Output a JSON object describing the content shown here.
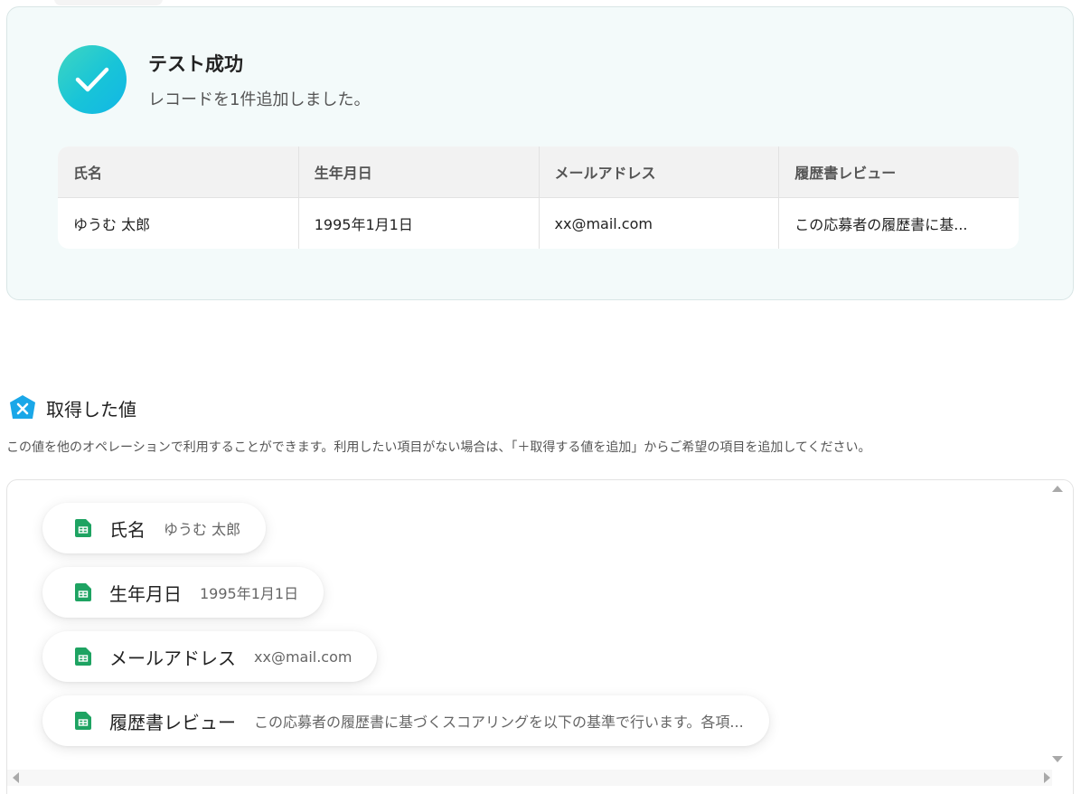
{
  "success": {
    "title": "テスト成功",
    "subtitle": "レコードを1件追加しました。",
    "icon": "check-icon",
    "accent": "#18c4d8"
  },
  "result_table": {
    "headers": [
      "氏名",
      "生年月日",
      "メールアドレス",
      "履歴書レビュー"
    ],
    "row": [
      "ゆうむ 太郎",
      "1995年1月1日",
      "xx@mail.com",
      "この応募者の履歴書に基..."
    ]
  },
  "section": {
    "title": "取得した値",
    "description": "この値を他のオペレーションで利用することができます。利用したい項目がない場合は、「＋取得する値を追加」からご希望の項目を追加してください。",
    "icon": "variable-x-icon",
    "icon_color": "#1aa7e8"
  },
  "values": [
    {
      "label": "氏名",
      "value": "ゆうむ 太郎",
      "icon": "spreadsheet-icon"
    },
    {
      "label": "生年月日",
      "value": "1995年1月1日",
      "icon": "spreadsheet-icon"
    },
    {
      "label": "メールアドレス",
      "value": "xx@mail.com",
      "icon": "spreadsheet-icon"
    },
    {
      "label": "履歴書レビュー",
      "value": "この応募者の履歴書に基づくスコアリングを以下の基準で行います。各項...",
      "icon": "spreadsheet-icon"
    }
  ],
  "colors": {
    "sheet_green": "#1ea362",
    "card_bg": "#f3fafa"
  }
}
